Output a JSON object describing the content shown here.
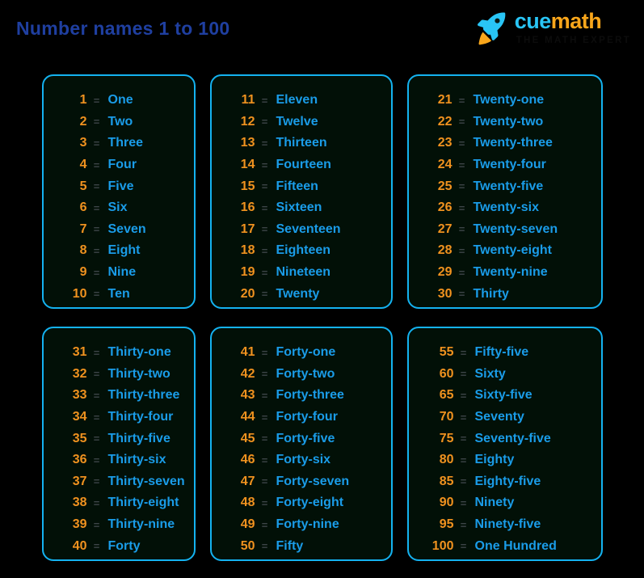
{
  "header": {
    "title": "Number names 1 to 100",
    "logo": {
      "icon": "rocket-icon",
      "word_primary": "cue",
      "word_secondary": "math",
      "tagline": "THE MATH EXPERT"
    }
  },
  "colors": {
    "page_background": "#000000",
    "card_background": "#021007",
    "card_border": "#14b2f0",
    "title": "#1f3fa0",
    "number": "#f0921f",
    "equals": "#3d4548",
    "name": "#1a9ce8",
    "logo_cue": "#29c5f6",
    "logo_math": "#f9a61b",
    "tagline": "#0c0c0c"
  },
  "equals_symbol": "=",
  "cards": [
    {
      "id": "card-1-to-10",
      "rows": [
        {
          "number": "1",
          "name": "One"
        },
        {
          "number": "2",
          "name": "Two"
        },
        {
          "number": "3",
          "name": "Three"
        },
        {
          "number": "4",
          "name": "Four"
        },
        {
          "number": "5",
          "name": "Five"
        },
        {
          "number": "6",
          "name": "Six"
        },
        {
          "number": "7",
          "name": "Seven"
        },
        {
          "number": "8",
          "name": "Eight"
        },
        {
          "number": "9",
          "name": "Nine"
        },
        {
          "number": "10",
          "name": "Ten"
        }
      ]
    },
    {
      "id": "card-11-to-20",
      "rows": [
        {
          "number": "11",
          "name": "Eleven"
        },
        {
          "number": "12",
          "name": "Twelve"
        },
        {
          "number": "13",
          "name": "Thirteen"
        },
        {
          "number": "14",
          "name": "Fourteen"
        },
        {
          "number": "15",
          "name": "Fifteen"
        },
        {
          "number": "16",
          "name": "Sixteen"
        },
        {
          "number": "17",
          "name": "Seventeen"
        },
        {
          "number": "18",
          "name": "Eighteen"
        },
        {
          "number": "19",
          "name": "Nineteen"
        },
        {
          "number": "20",
          "name": "Twenty"
        }
      ]
    },
    {
      "id": "card-21-to-30",
      "rows": [
        {
          "number": "21",
          "name": "Twenty-one"
        },
        {
          "number": "22",
          "name": "Twenty-two"
        },
        {
          "number": "23",
          "name": "Twenty-three"
        },
        {
          "number": "24",
          "name": "Twenty-four"
        },
        {
          "number": "25",
          "name": "Twenty-five"
        },
        {
          "number": "26",
          "name": "Twenty-six"
        },
        {
          "number": "27",
          "name": "Twenty-seven"
        },
        {
          "number": "28",
          "name": "Twenty-eight"
        },
        {
          "number": "29",
          "name": "Twenty-nine"
        },
        {
          "number": "30",
          "name": "Thirty"
        }
      ]
    },
    {
      "id": "card-31-to-40",
      "rows": [
        {
          "number": "31",
          "name": "Thirty-one"
        },
        {
          "number": "32",
          "name": "Thirty-two"
        },
        {
          "number": "33",
          "name": "Thirty-three"
        },
        {
          "number": "34",
          "name": "Thirty-four"
        },
        {
          "number": "35",
          "name": "Thirty-five"
        },
        {
          "number": "36",
          "name": "Thirty-six"
        },
        {
          "number": "37",
          "name": "Thirty-seven"
        },
        {
          "number": "38",
          "name": "Thirty-eight"
        },
        {
          "number": "39",
          "name": "Thirty-nine"
        },
        {
          "number": "40",
          "name": "Forty"
        }
      ]
    },
    {
      "id": "card-41-to-50",
      "rows": [
        {
          "number": "41",
          "name": "Forty-one"
        },
        {
          "number": "42",
          "name": "Forty-two"
        },
        {
          "number": "43",
          "name": "Forty-three"
        },
        {
          "number": "44",
          "name": "Forty-four"
        },
        {
          "number": "45",
          "name": "Forty-five"
        },
        {
          "number": "46",
          "name": "Forty-six"
        },
        {
          "number": "47",
          "name": "Forty-seven"
        },
        {
          "number": "48",
          "name": "Forty-eight"
        },
        {
          "number": "49",
          "name": "Forty-nine"
        },
        {
          "number": "50",
          "name": "Fifty"
        }
      ]
    },
    {
      "id": "card-55-to-100",
      "rows": [
        {
          "number": "55",
          "name": "Fifty-five"
        },
        {
          "number": "60",
          "name": "Sixty"
        },
        {
          "number": "65",
          "name": "Sixty-five"
        },
        {
          "number": "70",
          "name": "Seventy"
        },
        {
          "number": "75",
          "name": "Seventy-five"
        },
        {
          "number": "80",
          "name": "Eighty"
        },
        {
          "number": "85",
          "name": "Eighty-five"
        },
        {
          "number": "90",
          "name": "Ninety"
        },
        {
          "number": "95",
          "name": "Ninety-five"
        },
        {
          "number": "100",
          "name": "One Hundred"
        }
      ]
    }
  ]
}
